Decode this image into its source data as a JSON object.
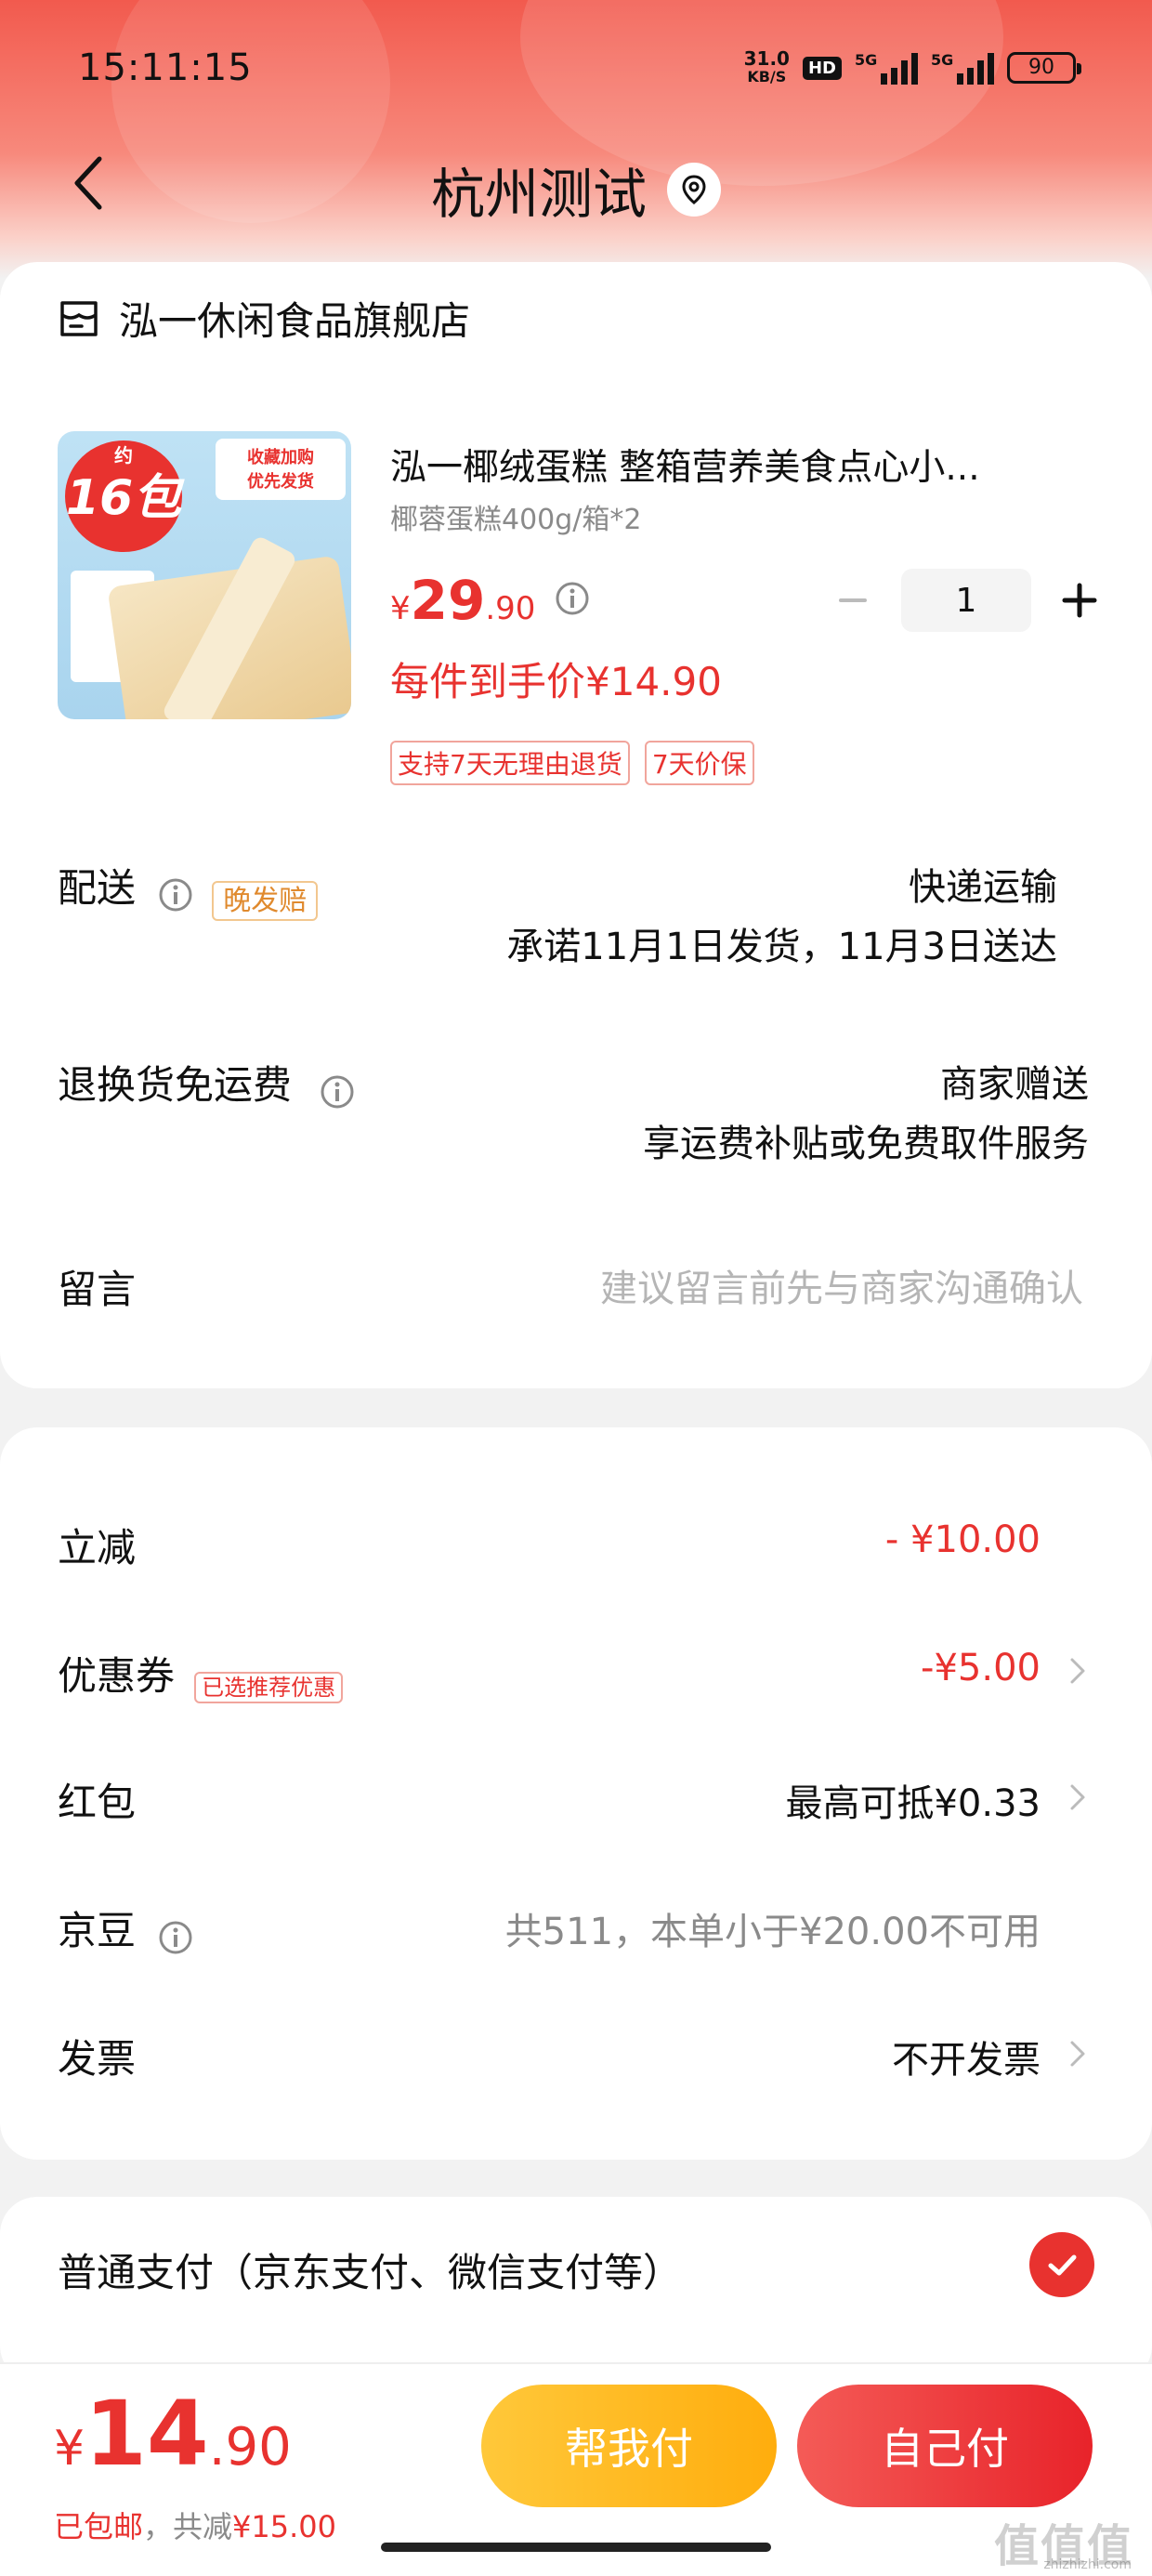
{
  "status_bar": {
    "time": "15:11:15",
    "speed_value": "31.0",
    "speed_unit": "KB/S",
    "hd_label": "HD",
    "signal1_tag": "5G",
    "signal2_tag": "5G",
    "battery": "90"
  },
  "nav": {
    "title": "杭州测试"
  },
  "store": {
    "name": "泓一休闲食品旗舰店"
  },
  "product": {
    "image_badge_small": "约",
    "image_badge": "16包",
    "image_tag_line1": "收藏加购",
    "image_tag_line2": "优先发货",
    "title": "泓一椰绒蛋糕 整箱营养美食点心小...",
    "spec": "椰蓉蛋糕400g/箱*2",
    "price_symbol": "¥",
    "price_int": "29",
    "price_dec": ".90",
    "quantity": "1",
    "unit_price": "每件到手价¥14.90",
    "tags": [
      "支持7天无理由退货",
      "7天价保"
    ]
  },
  "delivery": {
    "label": "配送",
    "badge": "晚发赔",
    "method": "快递运输",
    "promise": "承诺11月1日发货，11月3日送达"
  },
  "return_shipping": {
    "label": "退换货免运费",
    "value": "商家赠送",
    "desc": "享运费补贴或免费取件服务"
  },
  "message": {
    "label": "留言",
    "placeholder": "建议留言前先与商家沟通确认"
  },
  "discounts": {
    "instant": {
      "label": "立减",
      "value": "- ¥10.00"
    },
    "coupon": {
      "label": "优惠券",
      "badge": "已选推荐优惠",
      "value": "-¥5.00"
    },
    "red_packet": {
      "label": "红包",
      "value": "最高可抵¥0.33"
    },
    "jd_beans": {
      "label": "京豆",
      "value": "共511，本单小于¥20.00不可用"
    },
    "invoice": {
      "label": "发票",
      "value": "不开发票"
    }
  },
  "payment": {
    "label": "普通支付（京东支付、微信支付等）"
  },
  "footer": {
    "total_symbol": "¥",
    "total_int": "14",
    "total_dec": ".90",
    "shipping_note": "已包邮",
    "reduced_prefix": "，共减",
    "reduced_value": "¥15.00",
    "help_pay": "帮我付",
    "self_pay": "自己付"
  },
  "watermark": {
    "text": "值值值",
    "url": "zhizhizhi.com"
  },
  "colors": {
    "accent_red": "#e8322f",
    "help_yellow": "#ffb81c",
    "tag_orange": "#e08a2e"
  }
}
